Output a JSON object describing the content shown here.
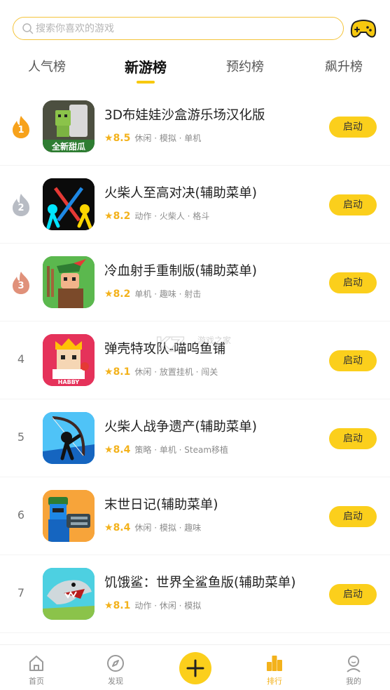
{
  "search": {
    "placeholder": "搜索你喜欢的游戏"
  },
  "tabs": [
    {
      "label": "人气榜"
    },
    {
      "label": "新游榜",
      "active": true
    },
    {
      "label": "预约榜"
    },
    {
      "label": "飙升榜"
    }
  ],
  "list": [
    {
      "rank": "1",
      "title": "3D布娃娃沙盒游乐场汉化版",
      "score": "8.5",
      "tags": "休闲 · 模拟 · 单机",
      "button": "启动",
      "icon_text": "全新甜瓜"
    },
    {
      "rank": "2",
      "title": "火柴人至高对决(辅助菜单)",
      "score": "8.2",
      "tags": "动作 · 火柴人 · 格斗",
      "button": "启动"
    },
    {
      "rank": "3",
      "title": "冷血射手重制版(辅助菜单)",
      "score": "8.2",
      "tags": "单机 · 趣味 · 射击",
      "button": "启动"
    },
    {
      "rank": "4",
      "title": "弹壳特攻队-喵呜鱼铺",
      "score": "8.1",
      "tags": "休闲 · 放置挂机 · 闯关",
      "button": "启动",
      "icon_text": "HABBY"
    },
    {
      "rank": "5",
      "title": "火柴人战争遗产(辅助菜单)",
      "score": "8.4",
      "tags": "策略 · 单机 · Steam移植",
      "button": "启动"
    },
    {
      "rank": "6",
      "title": "末世日记(辅助菜单)",
      "score": "8.4",
      "tags": "休闲 · 模拟 · 趣味",
      "button": "启动"
    },
    {
      "rank": "7",
      "title": "饥饿鲨：世界全鲨鱼版(辅助菜单)",
      "score": "8.1",
      "tags": "动作 · 休闲 · 模拟",
      "button": "启动"
    }
  ],
  "watermark": {
    "text": "游戏之家"
  },
  "bottom_nav": [
    {
      "label": "首页",
      "icon": "home-icon"
    },
    {
      "label": "发现",
      "icon": "compass-icon"
    },
    {
      "label": "",
      "icon": "plus-icon"
    },
    {
      "label": "排行",
      "icon": "ranking-icon",
      "active": true
    },
    {
      "label": "我的",
      "icon": "profile-icon"
    }
  ],
  "colors": {
    "accent": "#fbcf1c",
    "star": "#f3b21c",
    "search_border": "#f4c43b"
  }
}
